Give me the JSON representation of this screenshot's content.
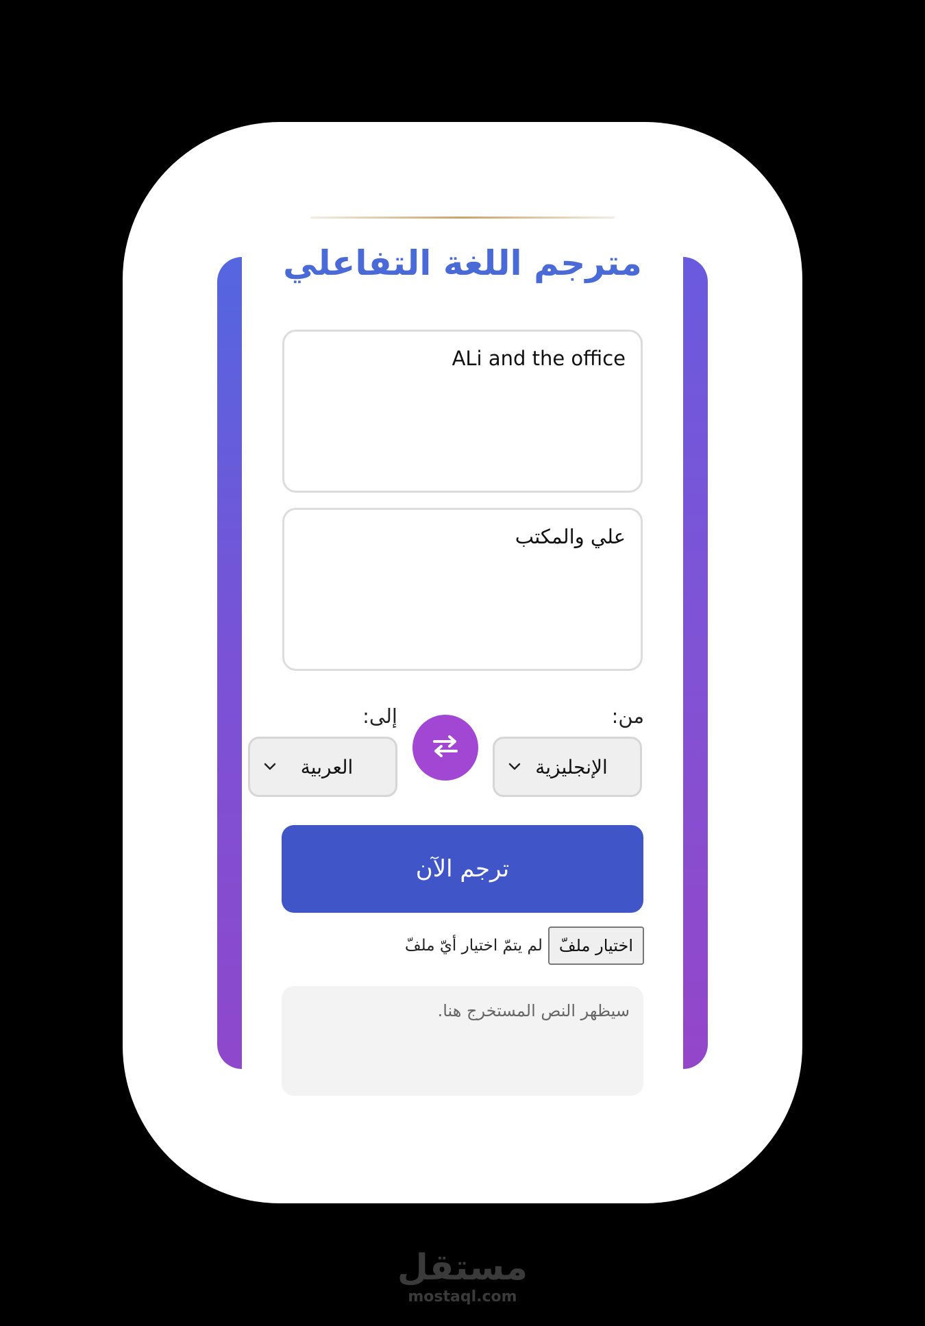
{
  "app": {
    "title": "مترجم اللغة التفاعلي"
  },
  "source_text": {
    "value": "ALi and the office"
  },
  "translated_text": {
    "value": "علي والمكتب"
  },
  "language": {
    "from_label": "من:",
    "to_label": "إلى:",
    "from_selected": "الإنجليزية",
    "to_selected": "العربية"
  },
  "actions": {
    "translate_label": "ترجم الآن",
    "swap_icon": "swap-arrows-icon"
  },
  "file": {
    "button_label": "اختيار ملفّ",
    "status": "لم يتمّ اختيار أيّ ملفّ"
  },
  "output": {
    "placeholder": "سيظهر النص المستخرج هنا."
  },
  "watermark": {
    "arabic": "مستقل",
    "latin": "mostaql.com"
  },
  "colors": {
    "title": "#4a6ad8",
    "translate_button": "#4056c8",
    "swap_button": "#a246d4"
  }
}
